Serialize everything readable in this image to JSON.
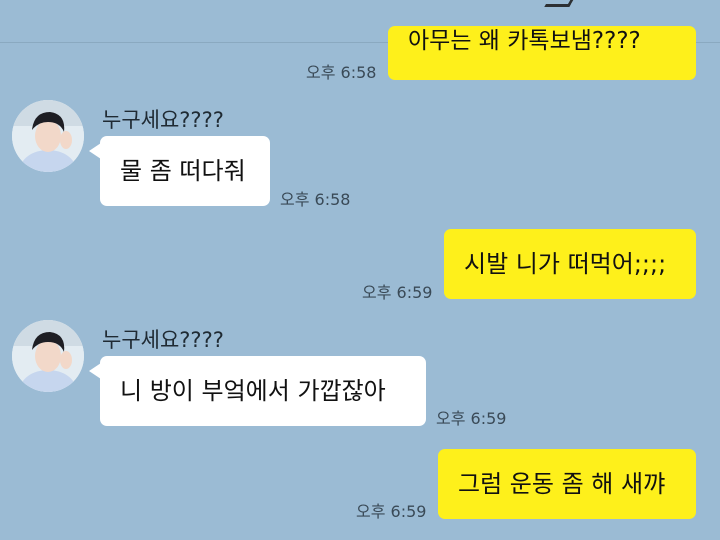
{
  "chat": {
    "messages": [
      {
        "side": "me",
        "text": "아무는 왜 카톡보냄????",
        "time": "오후 6:58"
      },
      {
        "side": "other",
        "sender": "누구세요????",
        "text": "물 좀 떠다줘",
        "time": "오후 6:58"
      },
      {
        "side": "me",
        "text": "시발 니가 떠먹어;;;;",
        "time": "오후 6:59"
      },
      {
        "side": "other",
        "sender": "누구세요????",
        "text": "니 방이 부엌에서 가깝잖아",
        "time": "오후 6:59"
      },
      {
        "side": "me",
        "text": "그럼 운동 좀 해 새꺄",
        "time": "오후 6:59"
      }
    ]
  },
  "colors": {
    "background": "#9bbbd4",
    "my_bubble": "#fef01b",
    "other_bubble": "#ffffff"
  },
  "icons": {
    "avatar": "profile-photo-icon"
  }
}
